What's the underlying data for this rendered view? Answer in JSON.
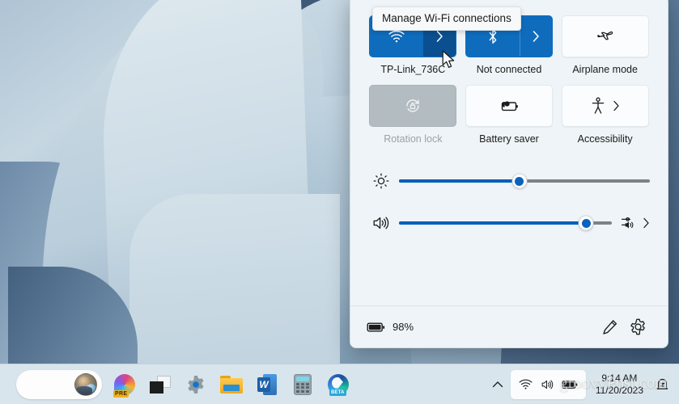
{
  "desktop": {
    "wallpaper_name": "windows-11-bloom-wallpaper",
    "watermark": "groovyPost.com"
  },
  "quick_settings": {
    "tooltip": {
      "text": "Manage Wi-Fi connections",
      "target": "wifi-expand-chevron"
    },
    "tiles": [
      {
        "id": "wifi",
        "label": "TP-Link_736C",
        "icon": "wifi-icon",
        "state": "on",
        "split": true,
        "chevron_hovered": true,
        "accent": "#0f6cbd"
      },
      {
        "id": "bluetooth",
        "label": "Not connected",
        "icon": "bluetooth-icon",
        "state": "on",
        "split": true,
        "chevron_hovered": false,
        "accent": "#0f6cbd"
      },
      {
        "id": "airplane-mode",
        "label": "Airplane mode",
        "icon": "airplane-icon",
        "state": "off",
        "split": false,
        "chevron_hovered": false
      },
      {
        "id": "rotation-lock",
        "label": "Rotation lock",
        "icon": "rotation-lock-icon",
        "state": "disabled",
        "split": false,
        "chevron_hovered": false
      },
      {
        "id": "battery-saver",
        "label": "Battery saver",
        "icon": "battery-saver-icon",
        "state": "off",
        "split": false,
        "chevron_hovered": false
      },
      {
        "id": "accessibility",
        "label": "Accessibility",
        "icon": "accessibility-icon",
        "state": "off",
        "split": false,
        "inline_chevron": true,
        "chevron_hovered": false
      }
    ],
    "sliders": [
      {
        "id": "brightness",
        "icon": "brightness-icon",
        "value": 48,
        "fill_color": "#005fb8",
        "track_color": "#7c8387"
      },
      {
        "id": "volume",
        "icon": "volume-icon",
        "value": 88,
        "fill_color": "#005fb8",
        "track_color": "#7c8387",
        "trailing_icon": "volume-mixer-icon",
        "trailing_chevron": true
      }
    ],
    "footer": {
      "battery_icon": "battery-icon",
      "battery_percent": "98%",
      "edit_button": "edit-quick-settings",
      "settings_button": "open-settings"
    }
  },
  "taskbar": {
    "start": {
      "icon": "user-avatar",
      "name": "start-button"
    },
    "apps": [
      {
        "id": "copilot",
        "icon": "copilot-icon",
        "badge": "PRE"
      },
      {
        "id": "task-view",
        "icon": "task-view-icon"
      },
      {
        "id": "settings",
        "icon": "settings-gear-icon"
      },
      {
        "id": "file-explorer",
        "icon": "file-explorer-icon"
      },
      {
        "id": "word",
        "icon": "word-icon",
        "glyph": "W"
      },
      {
        "id": "calculator",
        "icon": "calculator-icon"
      },
      {
        "id": "edge",
        "icon": "edge-icon",
        "badge": "BETA"
      }
    ],
    "tray": {
      "chevron": "show-hidden-icons",
      "icons": [
        "wifi-icon",
        "volume-icon",
        "battery-icon"
      ],
      "time": "9:14 AM",
      "date": "11/20/2023",
      "notifications": "notification-bell-icon"
    }
  }
}
